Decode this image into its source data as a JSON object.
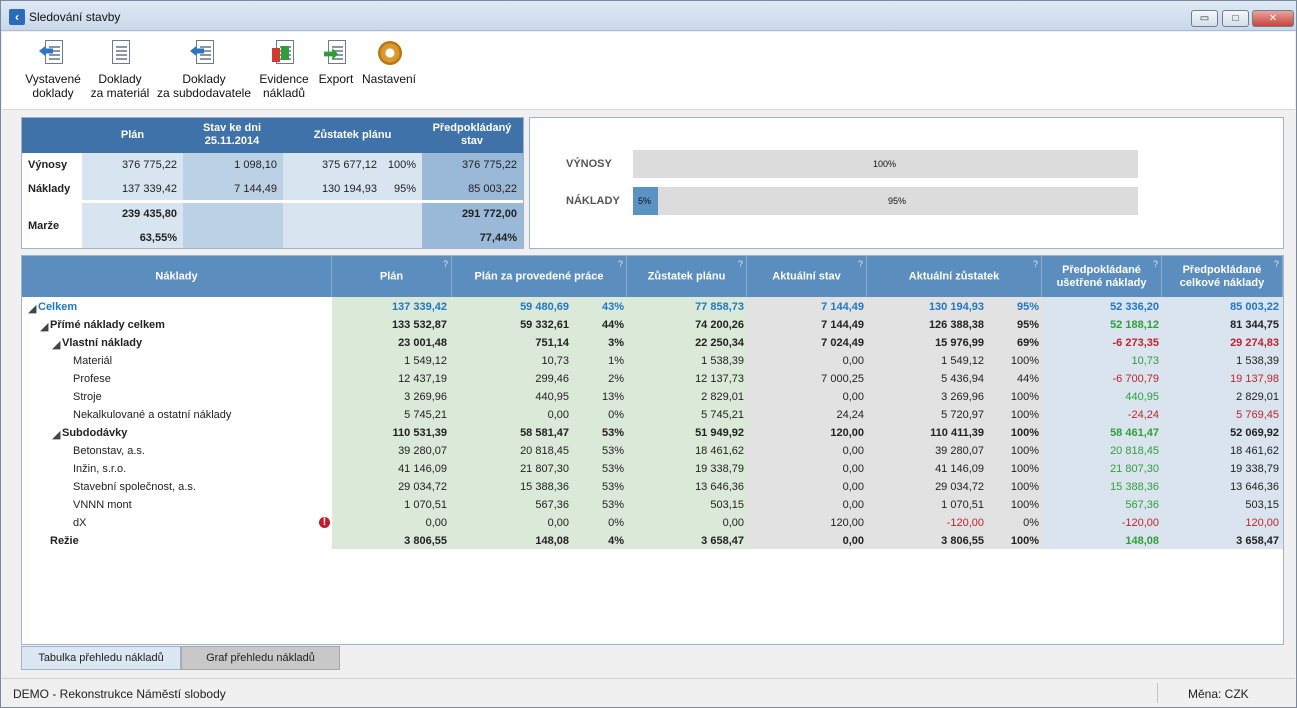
{
  "window": {
    "title": "Sledování stavby",
    "buttons": {
      "minimize": "▭",
      "maximize": "□",
      "close": "✕"
    }
  },
  "toolbar": {
    "items": [
      {
        "line1": "Vystavené",
        "line2": "doklady",
        "icon": "document-arrow-icon"
      },
      {
        "line1": "Doklady",
        "line2": "za materiál",
        "icon": "document-icon"
      },
      {
        "line1": "Doklady",
        "line2": "za subdodavatele",
        "icon": "document-arrow-icon"
      },
      {
        "line1": "Evidence",
        "line2": "nákladů",
        "icon": "cost-record-icon"
      },
      {
        "line1": "Export",
        "line2": "",
        "icon": "excel-export-icon"
      },
      {
        "line1": "Nastavení",
        "line2": "",
        "icon": "gear-icon"
      }
    ]
  },
  "summary": {
    "headers": {
      "plan": "Plán",
      "stav": "Stav ke dni 25.11.2014",
      "zustatek": "Zůstatek plánu",
      "predpokladany": "Předpokládaný stav"
    },
    "vynosy": {
      "label": "Výnosy",
      "plan": "376 775,22",
      "stav": "1 098,10",
      "zustatek": "375 677,12",
      "zustatek_pct": "100%",
      "pred": "376 775,22"
    },
    "naklady": {
      "label": "Náklady",
      "plan": "137 339,42",
      "stav": "7 144,49",
      "zustatek": "130 194,93",
      "zustatek_pct": "95%",
      "pred": "85 003,22"
    },
    "marze": {
      "label": "Marže",
      "plan": "239 435,80",
      "plan_pct": "63,55%",
      "pred": "291 772,00",
      "pred_pct": "77,44%"
    }
  },
  "progress": {
    "vynosy": {
      "label": "VÝNOSY",
      "fill_fraction": 0.0,
      "fill_text": "",
      "rest_text": "100%"
    },
    "naklady": {
      "label": "NÁKLADY",
      "fill_fraction": 0.05,
      "fill_text": "5%",
      "rest_text": "95%"
    }
  },
  "grid": {
    "headers": {
      "naklady": "Náklady",
      "plan": "Plán",
      "plan_provedene": "Plán za provedené práce",
      "zustatek": "Zůstatek plánu",
      "aktualni_stav": "Aktuální stav",
      "aktualni_zustatek": "Aktuální zůstatek",
      "usetrene": "Předpokládané ušetřené náklady",
      "celkove": "Předpokládané celkové náklady",
      "help": "?"
    },
    "rows": [
      {
        "name": "Celkem",
        "plan": "137 339,42",
        "pp": "59 480,69",
        "pp_pct": "43%",
        "zust": "77 858,73",
        "akt": "7 144,49",
        "az": "130 194,93",
        "az_pct": "95%",
        "us": "52 336,20",
        "cel": "85 003,22"
      },
      {
        "name": "Přímé náklady celkem",
        "plan": "133 532,87",
        "pp": "59 332,61",
        "pp_pct": "44%",
        "zust": "74 200,26",
        "akt": "7 144,49",
        "az": "126 388,38",
        "az_pct": "95%",
        "us": "52 188,12",
        "cel": "81 344,75"
      },
      {
        "name": "Vlastní náklady",
        "plan": "23 001,48",
        "pp": "751,14",
        "pp_pct": "3%",
        "zust": "22 250,34",
        "akt": "7 024,49",
        "az": "15 976,99",
        "az_pct": "69%",
        "us": "-6 273,35",
        "cel": "29 274,83"
      },
      {
        "name": "Materiál",
        "plan": "1 549,12",
        "pp": "10,73",
        "pp_pct": "1%",
        "zust": "1 538,39",
        "akt": "0,00",
        "az": "1 549,12",
        "az_pct": "100%",
        "us": "10,73",
        "cel": "1 538,39"
      },
      {
        "name": "Profese",
        "plan": "12 437,19",
        "pp": "299,46",
        "pp_pct": "2%",
        "zust": "12 137,73",
        "akt": "7 000,25",
        "az": "5 436,94",
        "az_pct": "44%",
        "us": "-6 700,79",
        "cel": "19 137,98"
      },
      {
        "name": "Stroje",
        "plan": "3 269,96",
        "pp": "440,95",
        "pp_pct": "13%",
        "zust": "2 829,01",
        "akt": "0,00",
        "az": "3 269,96",
        "az_pct": "100%",
        "us": "440,95",
        "cel": "2 829,01"
      },
      {
        "name": "Nekalkulované a ostatní náklady",
        "plan": "5 745,21",
        "pp": "0,00",
        "pp_pct": "0%",
        "zust": "5 745,21",
        "akt": "24,24",
        "az": "5 720,97",
        "az_pct": "100%",
        "us": "-24,24",
        "cel": "5 769,45"
      },
      {
        "name": "Subdodávky",
        "plan": "110 531,39",
        "pp": "58 581,47",
        "pp_pct": "53%",
        "zust": "51 949,92",
        "akt": "120,00",
        "az": "110 411,39",
        "az_pct": "100%",
        "us": "58 461,47",
        "cel": "52 069,92"
      },
      {
        "name": "Betonstav, a.s.",
        "plan": "39 280,07",
        "pp": "20 818,45",
        "pp_pct": "53%",
        "zust": "18 461,62",
        "akt": "0,00",
        "az": "39 280,07",
        "az_pct": "100%",
        "us": "20 818,45",
        "cel": "18 461,62"
      },
      {
        "name": "Inžin, s.r.o.",
        "plan": "41 146,09",
        "pp": "21 807,30",
        "pp_pct": "53%",
        "zust": "19 338,79",
        "akt": "0,00",
        "az": "41 146,09",
        "az_pct": "100%",
        "us": "21 807,30",
        "cel": "19 338,79"
      },
      {
        "name": "Stavební společnost, a.s.",
        "plan": "29 034,72",
        "pp": "15 388,36",
        "pp_pct": "53%",
        "zust": "13 646,36",
        "akt": "0,00",
        "az": "29 034,72",
        "az_pct": "100%",
        "us": "15 388,36",
        "cel": "13 646,36"
      },
      {
        "name": "VNNN mont",
        "plan": "1 070,51",
        "pp": "567,36",
        "pp_pct": "53%",
        "zust": "503,15",
        "akt": "0,00",
        "az": "1 070,51",
        "az_pct": "100%",
        "us": "567,36",
        "cel": "503,15"
      },
      {
        "name": "dX",
        "plan": "0,00",
        "pp": "0,00",
        "pp_pct": "0%",
        "zust": "0,00",
        "akt": "120,00",
        "az": "-120,00",
        "az_pct": "0%",
        "us": "-120,00",
        "cel": "120,00"
      },
      {
        "name": "Režie",
        "plan": "3 806,55",
        "pp": "148,08",
        "pp_pct": "4%",
        "zust": "3 658,47",
        "akt": "0,00",
        "az": "3 806,55",
        "az_pct": "100%",
        "us": "148,08",
        "cel": "3 658,47"
      }
    ],
    "error_mark": "!"
  },
  "tabs": {
    "table": "Tabulka přehledu nákladů",
    "graph": "Graf přehledu nákladů"
  },
  "statusbar": {
    "project": "DEMO - Rekonstrukce Náměstí slobody",
    "currency": "Měna: CZK"
  },
  "colors": {
    "header": "#5c8dbf",
    "positive": "#2f9e3a",
    "negative": "#c0232c",
    "total": "#1f77c6"
  }
}
